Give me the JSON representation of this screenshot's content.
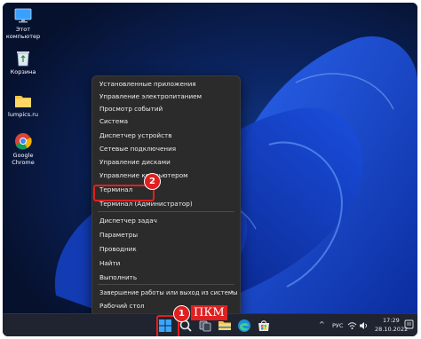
{
  "desktop": {
    "icons": [
      {
        "name": "this-pc",
        "label": "Этот компьютер"
      },
      {
        "name": "recycle-bin",
        "label": "Корзина"
      },
      {
        "name": "folder",
        "label": "lumpics.ru"
      },
      {
        "name": "google-chrome",
        "label": "Google Chrome"
      }
    ]
  },
  "context_menu": {
    "items": [
      "Установленные приложения",
      "Управление электропитанием",
      "Просмотр событий",
      "Система",
      "Диспетчер устройств",
      "Сетевые подключения",
      "Управление дисками",
      "Управление компьютером",
      "Терминал",
      "Терминал (Администратор)",
      "Диспетчер задач",
      "Параметры",
      "Проводник",
      "Найти",
      "Выполнить",
      "Завершение работы или выход из системы",
      "Рабочий стол"
    ]
  },
  "annotations": {
    "step1_number": "1",
    "step1_label": "ПКМ",
    "step2_number": "2",
    "highlight_color": "#e02020"
  },
  "taskbar": {
    "language": "РУС",
    "time": "17:29",
    "date": "28.10.2022",
    "icons": [
      "start-icon",
      "search-icon",
      "task-view-icon",
      "file-explorer-icon",
      "edge-icon",
      "store-icon"
    ]
  }
}
